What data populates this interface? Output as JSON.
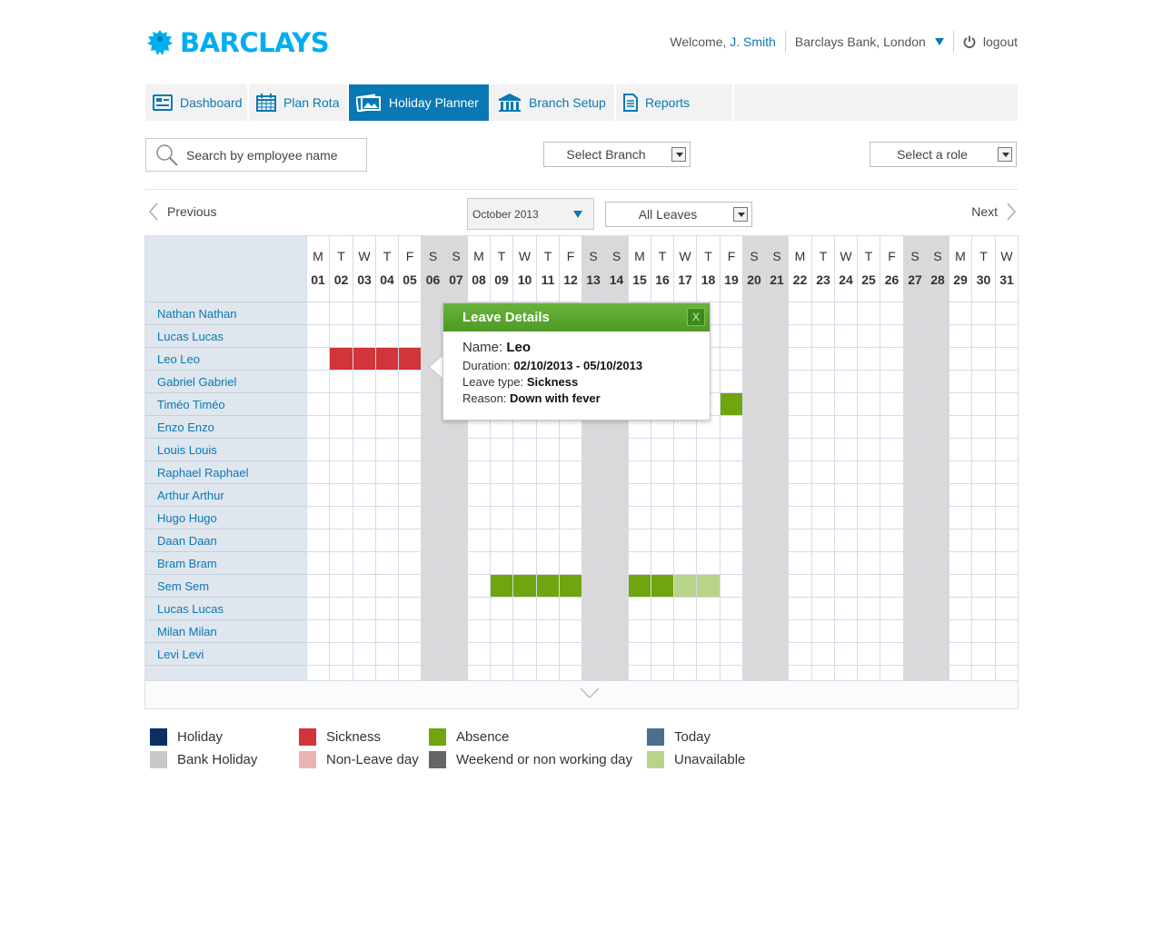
{
  "brand": {
    "name": "BARCLAYS",
    "color": "#00aeef"
  },
  "header": {
    "welcome_prefix": "Welcome,",
    "user_name": "J. Smith",
    "branch": "Barclays Bank, London",
    "logout": "logout"
  },
  "nav": {
    "tabs": [
      {
        "label": "Dashboard",
        "icon": "dashboard-icon",
        "active": false
      },
      {
        "label": "Plan Rota",
        "icon": "calendar-icon",
        "active": false
      },
      {
        "label": "Holiday Planner",
        "icon": "photos-icon",
        "active": true
      },
      {
        "label": "Branch Setup",
        "icon": "bank-icon",
        "active": false
      },
      {
        "label": "Reports",
        "icon": "document-icon",
        "active": false
      }
    ]
  },
  "filters": {
    "search_placeholder": "Search by employee name",
    "branch_select": "Select Branch",
    "role_select": "Select a role"
  },
  "month_bar": {
    "previous": "Previous",
    "next": "Next",
    "month": "October 2013",
    "leave_filter": "All Leaves"
  },
  "calendar": {
    "days": [
      {
        "l": "M",
        "n": "01"
      },
      {
        "l": "T",
        "n": "02"
      },
      {
        "l": "W",
        "n": "03"
      },
      {
        "l": "T",
        "n": "04"
      },
      {
        "l": "F",
        "n": "05"
      },
      {
        "l": "S",
        "n": "06",
        "we": true
      },
      {
        "l": "S",
        "n": "07",
        "we": true
      },
      {
        "l": "M",
        "n": "08"
      },
      {
        "l": "T",
        "n": "09"
      },
      {
        "l": "W",
        "n": "10"
      },
      {
        "l": "T",
        "n": "11"
      },
      {
        "l": "F",
        "n": "12"
      },
      {
        "l": "S",
        "n": "13",
        "we": true
      },
      {
        "l": "S",
        "n": "14",
        "we": true
      },
      {
        "l": "M",
        "n": "15"
      },
      {
        "l": "T",
        "n": "16"
      },
      {
        "l": "W",
        "n": "17"
      },
      {
        "l": "T",
        "n": "18"
      },
      {
        "l": "F",
        "n": "19"
      },
      {
        "l": "S",
        "n": "20",
        "we": true
      },
      {
        "l": "S",
        "n": "21",
        "we": true
      },
      {
        "l": "M",
        "n": "22"
      },
      {
        "l": "T",
        "n": "23"
      },
      {
        "l": "W",
        "n": "24"
      },
      {
        "l": "T",
        "n": "25"
      },
      {
        "l": "F",
        "n": "26"
      },
      {
        "l": "S",
        "n": "27",
        "we": true
      },
      {
        "l": "S",
        "n": "28",
        "we": true
      },
      {
        "l": "M",
        "n": "29"
      },
      {
        "l": "T",
        "n": "30"
      },
      {
        "l": "W",
        "n": "31"
      }
    ],
    "employees": [
      "Nathan Nathan",
      "Lucas Lucas",
      "Leo Leo",
      "Gabriel Gabriel",
      "Timéo Timéo",
      "Enzo Enzo",
      "Louis Louis",
      "Raphael Raphael",
      "Arthur Arthur",
      "Hugo Hugo",
      "Daan Daan",
      "Bram Bram",
      "Sem Sem",
      "Lucas Lucas",
      "Milan Milan",
      "Levi Levi"
    ],
    "leaves": [
      {
        "employee": "Leo Leo",
        "type": "sickness",
        "from": "02",
        "to": "05"
      },
      {
        "employee": "Timéo Timéo",
        "type": "absence",
        "from": "19",
        "to": "19"
      },
      {
        "employee": "Sem Sem",
        "type": "absence",
        "from": "09",
        "to": "12"
      },
      {
        "employee": "Sem Sem",
        "type": "absence",
        "from": "15",
        "to": "16"
      },
      {
        "employee": "Sem Sem",
        "type": "unavailable",
        "from": "17",
        "to": "18"
      }
    ]
  },
  "popup": {
    "title": "Leave Details",
    "close": "X",
    "name_label": "Name:",
    "name": "Leo",
    "duration_label": "Duration:",
    "duration": "02/10/2013 - 05/10/2013",
    "type_label": "Leave type:",
    "type": "Sickness",
    "reason_label": "Reason:",
    "reason": "Down with fever"
  },
  "legend": [
    {
      "label": "Holiday",
      "color": "#0b2f62"
    },
    {
      "label": "Bank Holiday",
      "color": "#c8c8c8"
    },
    {
      "label": "Sickness",
      "color": "#d1343a"
    },
    {
      "label": "Non-Leave day",
      "color": "#eab3b3"
    },
    {
      "label": "Absence",
      "color": "#6fa50f"
    },
    {
      "label": "Weekend or non working day",
      "color": "#666666"
    },
    {
      "label": "Today",
      "color": "#4a6f8f"
    },
    {
      "label": "Unavailable",
      "color": "#b7d48a"
    }
  ],
  "colors": {
    "accent": "#0a78b4",
    "sickness": "#d1343a",
    "absence": "#6fa50f",
    "unavailable": "#b7d48a"
  }
}
